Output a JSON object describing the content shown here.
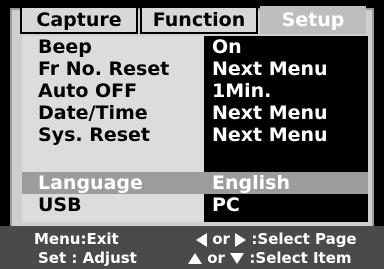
{
  "tabs": {
    "capture": "Capture",
    "function": "Function",
    "setup": "Setup"
  },
  "settings": [
    {
      "label": "Beep",
      "value": "On"
    },
    {
      "label": "Fr No. Reset",
      "value": "Next Menu"
    },
    {
      "label": "Auto OFF",
      "value": "1Min."
    },
    {
      "label": "Date/Time",
      "value": "Next Menu"
    },
    {
      "label": "Sys. Reset",
      "value": "Next Menu"
    },
    {
      "label": "Language",
      "value": "English"
    },
    {
      "label": "USB",
      "value": "PC"
    }
  ],
  "help": {
    "menu_exit": "Menu:Exit",
    "set_adjust": "Set : Adjust",
    "or1": "or",
    "or2": "or",
    "select_page": ":Select Page",
    "select_item": ":Select Item"
  },
  "colors": {
    "selected_row": "#9c9c9c",
    "active_tab": "#bdbdbd"
  }
}
